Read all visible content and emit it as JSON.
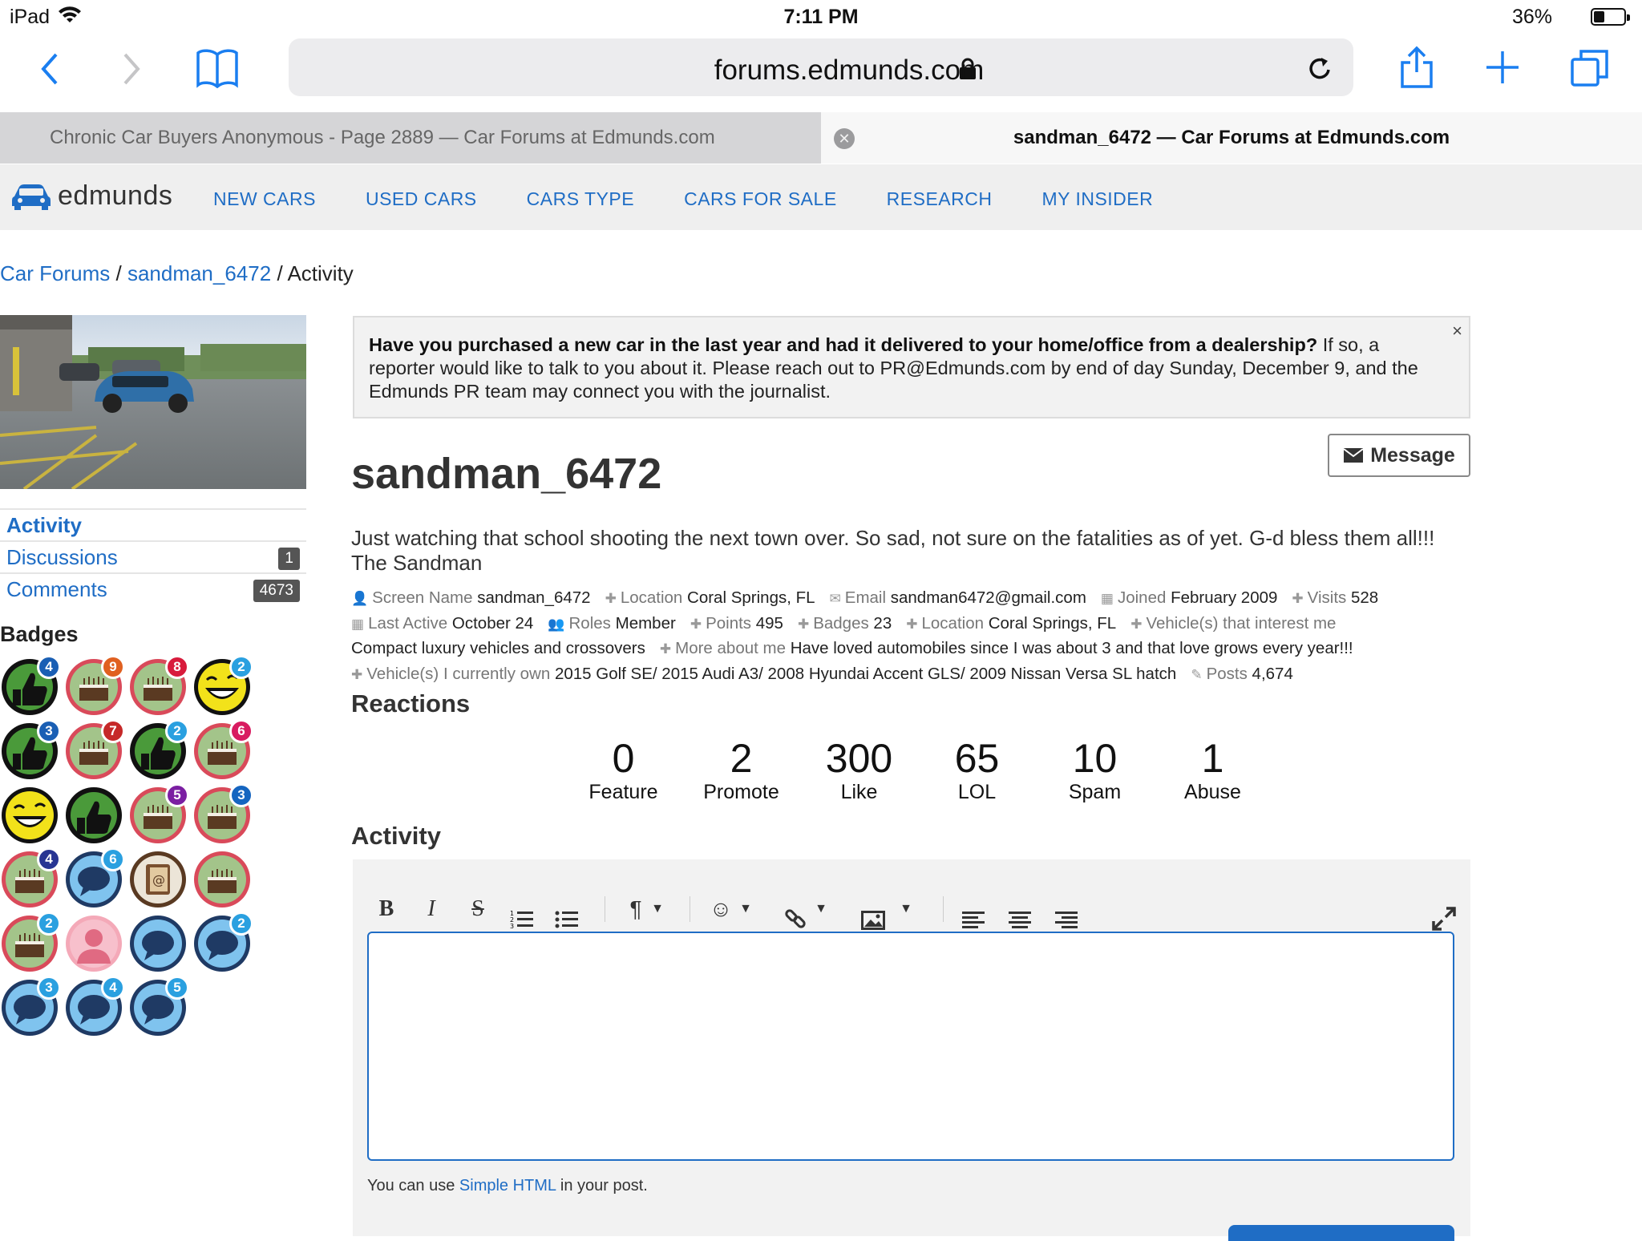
{
  "status": {
    "device": "iPad",
    "time": "7:11 PM",
    "battery": "36%",
    "battery_level": 0.36
  },
  "browser": {
    "url": "forums.edmunds.com",
    "tabs": [
      {
        "title": "Chronic Car Buyers Anonymous - Page 2889 — Car Forums at Edmunds.com",
        "active": false
      },
      {
        "title": "sandman_6472 — Car Forums at Edmunds.com",
        "active": true
      }
    ]
  },
  "site": {
    "logo": "edmunds",
    "nav": [
      "NEW CARS",
      "USED CARS",
      "CARS TYPE",
      "CARS FOR SALE",
      "RESEARCH",
      "MY INSIDER"
    ]
  },
  "breadcrumb": {
    "root": "Car Forums",
    "user": "sandman_6472",
    "current": "Activity"
  },
  "sidebar": {
    "items": [
      {
        "label": "Activity",
        "count": ""
      },
      {
        "label": "Discussions",
        "count": "1"
      },
      {
        "label": "Comments",
        "count": "4673"
      }
    ],
    "badges_title": "Badges",
    "badges": [
      {
        "type": "thumb",
        "count": "4",
        "color": "#1a5fb4"
      },
      {
        "type": "cake",
        "count": "9",
        "color": "#e06020"
      },
      {
        "type": "cake",
        "count": "8",
        "color": "#d81b3c"
      },
      {
        "type": "laugh",
        "count": "2",
        "color": "#2aa0e0"
      },
      {
        "type": "thumb",
        "count": "3",
        "color": "#1a5fb4"
      },
      {
        "type": "cake",
        "count": "7",
        "color": "#c62828"
      },
      {
        "type": "thumb",
        "count": "2",
        "color": "#2aa0e0"
      },
      {
        "type": "cake",
        "count": "6",
        "color": "#d81b60"
      },
      {
        "type": "laugh",
        "count": "",
        "color": ""
      },
      {
        "type": "thumb",
        "count": "",
        "color": ""
      },
      {
        "type": "cake",
        "count": "5",
        "color": "#7b1fa2"
      },
      {
        "type": "cake",
        "count": "3",
        "color": "#1565c0"
      },
      {
        "type": "cake",
        "count": "4",
        "color": "#283593"
      },
      {
        "type": "comment",
        "count": "6",
        "color": "#2aa0e0"
      },
      {
        "type": "address",
        "count": "",
        "color": ""
      },
      {
        "type": "cake",
        "count": "",
        "color": ""
      },
      {
        "type": "cake",
        "count": "2",
        "color": "#2aa0e0"
      },
      {
        "type": "person",
        "count": "",
        "color": ""
      },
      {
        "type": "comment",
        "count": "",
        "color": ""
      },
      {
        "type": "comment",
        "count": "2",
        "color": "#2aa0e0"
      },
      {
        "type": "comment",
        "count": "3",
        "color": "#2aa0e0"
      },
      {
        "type": "comment",
        "count": "4",
        "color": "#2aa0e0"
      },
      {
        "type": "comment",
        "count": "5",
        "color": "#2aa0e0"
      }
    ]
  },
  "notice": {
    "bold": "Have you purchased a new car in the last year and had it delivered to your home/office from a dealership?",
    "text": " If so, a reporter would like to talk to you about it. Please reach out to PR@Edmunds.com by end of day Sunday, December 9, and the Edmunds PR team may connect you with the journalist.",
    "close": "×"
  },
  "profile": {
    "message_button": "Message",
    "username": "sandman_6472",
    "about": "Just watching that school shooting the next town over. So sad, not sure on the fatalities as of yet. G-d bless them all!!! The Sandman",
    "meta_lines": [
      [
        {
          "icon": "person-icon",
          "k": "Screen Name",
          "v": "sandman_6472"
        },
        {
          "icon": "plus-icon",
          "k": "Location",
          "v": "Coral Springs, FL"
        },
        {
          "icon": "envelope-icon",
          "k": "Email",
          "v": "sandman6472@gmail.com"
        },
        {
          "icon": "calendar-icon",
          "k": "Joined",
          "v": "February 2009"
        },
        {
          "icon": "plus-icon",
          "k": "Visits",
          "v": "528"
        }
      ],
      [
        {
          "icon": "calendar-icon",
          "k": "Last Active",
          "v": "October 24"
        },
        {
          "icon": "people-icon",
          "k": "Roles",
          "v": "Member"
        },
        {
          "icon": "plus-icon",
          "k": "Points",
          "v": "495"
        },
        {
          "icon": "plus-icon",
          "k": "Badges",
          "v": "23"
        },
        {
          "icon": "plus-icon",
          "k": "Location",
          "v": "Coral Springs, FL"
        },
        {
          "icon": "plus-icon",
          "k": "Vehicle(s) that interest me",
          "v": ""
        }
      ],
      [
        {
          "icon": "",
          "k": "",
          "v": "Compact luxury vehicles and crossovers"
        },
        {
          "icon": "plus-icon",
          "k": "More about me",
          "v": "Have loved automobiles since I was about 3 and that love grows every year!!!"
        }
      ],
      [
        {
          "icon": "plus-icon",
          "k": "Vehicle(s) I currently own",
          "v": "2015 Golf SE/ 2015 Audi A3/ 2008 Hyundai Accent GLS/ 2009 Nissan Versa SL hatch"
        },
        {
          "icon": "pencil-icon",
          "k": "Posts",
          "v": "4,674"
        }
      ]
    ]
  },
  "reactions": {
    "title": "Reactions",
    "items": [
      {
        "n": "0",
        "label": "Feature"
      },
      {
        "n": "2",
        "label": "Promote"
      },
      {
        "n": "300",
        "label": "Like"
      },
      {
        "n": "65",
        "label": "LOL"
      },
      {
        "n": "10",
        "label": "Spam"
      },
      {
        "n": "1",
        "label": "Abuse"
      }
    ]
  },
  "activity": {
    "title": "Activity",
    "hint_before": "You can use ",
    "hint_link": "Simple HTML",
    "hint_after": " in your post."
  }
}
